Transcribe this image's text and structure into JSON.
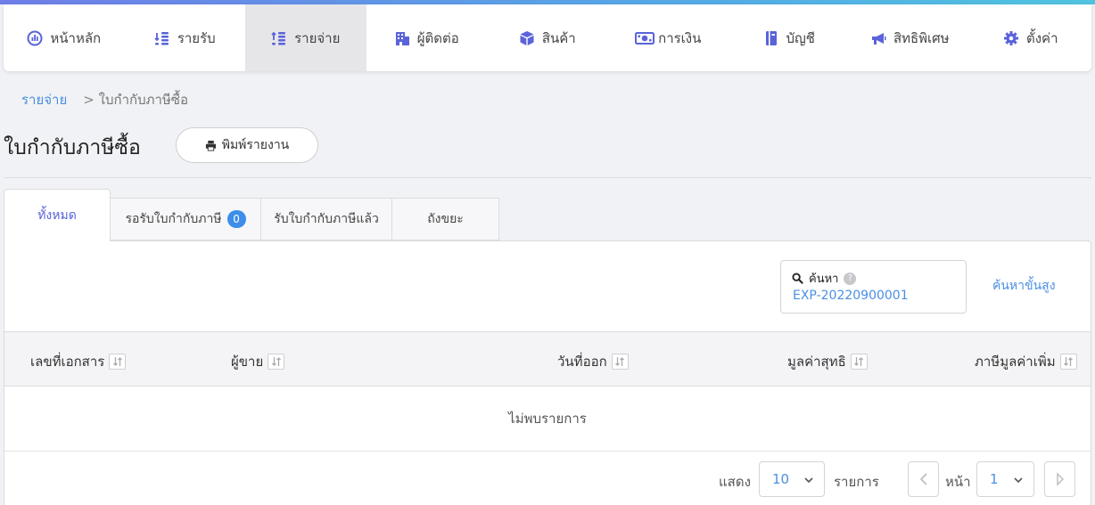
{
  "nav": {
    "items": [
      {
        "label": "หน้าหลัก",
        "icon": "dashboard-icon"
      },
      {
        "label": "รายรับ",
        "icon": "income-icon"
      },
      {
        "label": "รายจ่าย",
        "icon": "expense-icon",
        "active": true
      },
      {
        "label": "ผู้ติดต่อ",
        "icon": "contacts-icon"
      },
      {
        "label": "สินค้า",
        "icon": "product-box-icon"
      },
      {
        "label": "การเงิน",
        "icon": "money-icon"
      },
      {
        "label": "บัญชี",
        "icon": "book-icon"
      },
      {
        "label": "สิทธิพิเศษ",
        "icon": "megaphone-icon"
      },
      {
        "label": "ตั้งค่า",
        "icon": "gear-icon"
      }
    ]
  },
  "breadcrumb": {
    "parent": "รายจ่าย",
    "separator": ">",
    "current": "ใบกำกับภาษีซื้อ"
  },
  "page": {
    "title": "ใบกำกับภาษีซื้อ",
    "print_label": "พิมพ์รายงาน"
  },
  "tabs": [
    {
      "label": "ทั้งหมด",
      "active": true
    },
    {
      "label": "รอรับใบกำกับภาษี",
      "badge": "0"
    },
    {
      "label": "รับใบกำกับภาษีแล้ว"
    },
    {
      "label": "ถังขยะ"
    }
  ],
  "search": {
    "label": "ค้นหา",
    "help": "?",
    "value": "EXP-20220900001",
    "advanced_label": "ค้นหาขั้นสูง"
  },
  "table": {
    "columns": [
      "เลขที่เอกสาร",
      "ผู้ขาย",
      "วันที่ออก",
      "มูลค่าสุทธิ",
      "ภาษีมูลค่าเพิ่ม"
    ],
    "empty_text": "ไม่พบรายการ"
  },
  "pagination": {
    "show_label": "แสดง",
    "page_size": "10",
    "items_label": "รายการ",
    "page_label": "หน้า",
    "current_page": "1"
  },
  "colors": {
    "accent": "#5a63d8",
    "link": "#4a8fe2",
    "badge": "#3d8eea"
  }
}
